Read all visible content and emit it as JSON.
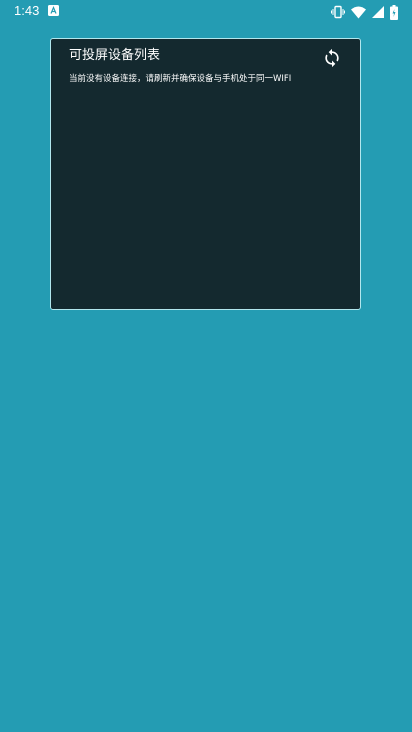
{
  "status_bar": {
    "time": "1:43",
    "app_icon": "app-a-icon",
    "icons": [
      "vibrate-icon",
      "wifi-icon",
      "signal-icon",
      "battery-icon"
    ]
  },
  "cast_panel": {
    "title": "可投屏设备列表",
    "message": "当前没有设备连接，请刷新并确保设备与手机处于同一WIFI",
    "refresh_icon": "refresh-icon"
  },
  "colors": {
    "background": "#249cb3",
    "panel": "#14292f",
    "panel_border": "#b2e7ee",
    "text": "#ffffff"
  }
}
